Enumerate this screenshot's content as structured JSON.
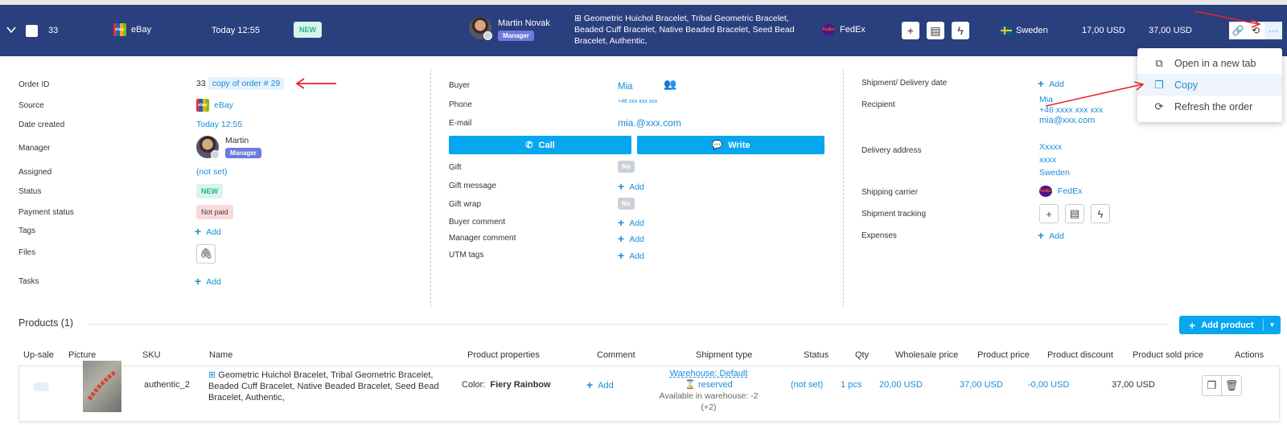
{
  "header": {
    "order_number": "33",
    "source": "eBay",
    "date": "Today 12:55",
    "status": "NEW",
    "manager_name": "Martin Novak",
    "manager_role": "Manager",
    "products": "Geometric Huichol Bracelet, Tribal Geometric Bracelet, Beaded Cuff Bracelet, Native Beaded Bracelet, Seed Bead Bracelet, Authentic,",
    "carrier": "FedEx",
    "country": "Sweden",
    "price1": "17,00 USD",
    "price2": "37,00 USD"
  },
  "menu": {
    "items": [
      {
        "label": "Open in a new tab",
        "icon": "open-tab-icon"
      },
      {
        "label": "Copy",
        "icon": "copy-icon"
      },
      {
        "label": "Refresh the order",
        "icon": "refresh-icon"
      }
    ]
  },
  "order": {
    "id_label": "Order ID",
    "id_value": "33",
    "copy_of": "copy of order # 29",
    "source_label": "Source",
    "source_value": "eBay",
    "date_label": "Date created",
    "date_value": "Today 12:55",
    "manager_label": "Manager",
    "manager_value": "Martin",
    "manager_role": "Manager",
    "assigned_label": "Assigned",
    "assigned_value": "(not set)",
    "status_label": "Status",
    "status_value": "NEW",
    "payment_label": "Payment status",
    "payment_value": "Not paid",
    "tags_label": "Tags",
    "files_label": "Files",
    "tasks_label": "Tasks",
    "add": "Add"
  },
  "buyer": {
    "buyer_label": "Buyer",
    "buyer_value": "Mia",
    "phone_label": "Phone",
    "phone_value": "+46 xxx xxx xxx",
    "email_label": "E-mail",
    "email_value": "mia.@xxx.com",
    "call": "Call",
    "write": "Write",
    "gift_label": "Gift",
    "gift_value": "No",
    "gift_message_label": "Gift message",
    "gift_wrap_label": "Gift wrap",
    "gift_wrap_value": "No",
    "buyer_comment_label": "Buyer comment",
    "manager_comment_label": "Manager comment",
    "utm_label": "UTM tags",
    "add": "Add"
  },
  "shipment": {
    "date_label": "Shipment/ Delivery date",
    "recipient_label": "Recipient",
    "recipient_name": "Mia",
    "recipient_phone": "+46 xxxx xxx xxx",
    "recipient_email": "mia@xxx.com",
    "address_label": "Delivery address",
    "address_1": "Xxxxx",
    "address_2": "xxxx",
    "address_3": "Sweden",
    "carrier_label": "Shipping carrier",
    "carrier_value": "FedEx",
    "tracking_label": "Shipment tracking",
    "expenses_label": "Expenses",
    "add": "Add"
  },
  "products": {
    "title": "Products (1)",
    "add_button": "Add product",
    "columns": [
      "Up-sale",
      "Picture",
      "SKU",
      "Name",
      "Product properties",
      "Comment",
      "Shipment type",
      "Status",
      "Qty",
      "Wholesale price",
      "Product price",
      "Product discount",
      "Product sold price",
      "Actions"
    ],
    "row": {
      "sku": "authentic_2",
      "name": "Geometric Huichol Bracelet, Tribal Geometric Bracelet, Beaded Cuff Bracelet, Native Beaded Bracelet, Seed Bead Bracelet, Authentic,",
      "prop_label": "Color:",
      "prop_value": "Fiery Rainbow",
      "comment": "Add",
      "warehouse": "Warehouse: Default",
      "reserved": "reserved",
      "available": "Available in warehouse: -2 (+2)",
      "status": "(not set)",
      "qty": "1 pcs",
      "wholesale": "20,00 USD",
      "price": "37,00 USD",
      "discount": "-0,00 USD",
      "sold": "37,00 USD"
    }
  },
  "colors": {
    "header_bg": "#2a3f7e",
    "accent": "#07a7f0",
    "link": "#1a8cd8",
    "annotation": "#e8232b"
  }
}
